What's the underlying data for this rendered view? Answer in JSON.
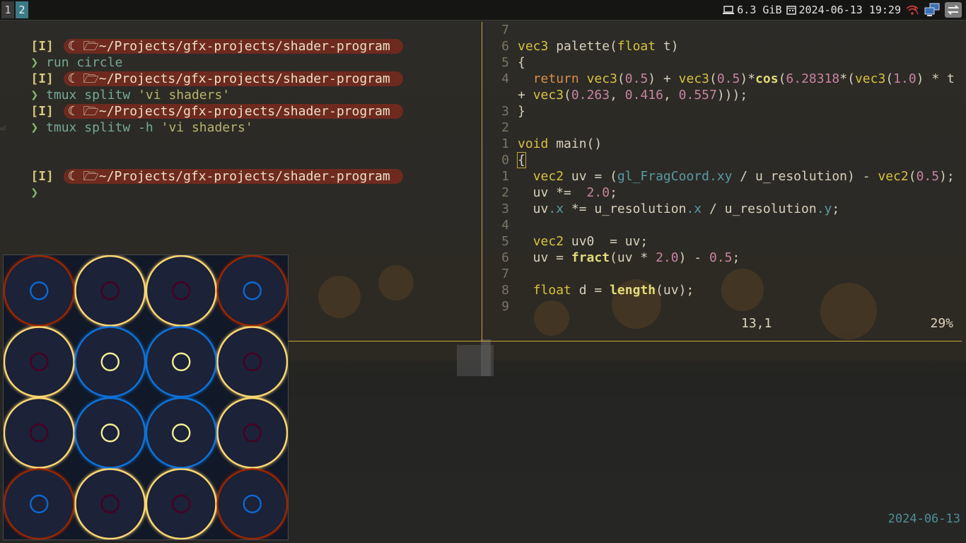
{
  "workspaces": [
    {
      "label": "1",
      "active": false
    },
    {
      "label": "2",
      "active": true
    }
  ],
  "tray": {
    "memory": "6.3 GiB",
    "datetime": "2024-06-13 19:29"
  },
  "terminal": {
    "mode_tag": "[I]",
    "path": "~/Projects/gfx-projects/shader-program",
    "prompt_symbol": "❯",
    "cmd1": "run circle",
    "cmd2_a": "tmux splitw ",
    "cmd2_b": "'vi shaders'",
    "cmd3_a": "tmux splitw -h ",
    "cmd3_b": "'vi shaders'",
    "return_glyph": "⏎"
  },
  "editor": {
    "lines": {
      "l7": "7",
      "l6": "6",
      "l5": "5",
      "l4": "4",
      "l3": "3",
      "l2": "2",
      "l1": "1",
      "l0": "0",
      "m1": "1",
      "m2": "2",
      "m3": "3",
      "m4": "4",
      "m5": "5",
      "m6": "6",
      "m7": "7",
      "m8": "8",
      "m9": "9"
    },
    "status_position": "13,1",
    "status_percent": "29%"
  },
  "bottom_date": "2024-06-13",
  "colors": {
    "accent": "#c8a43a",
    "pill": "#6e2a1f",
    "workspace_active": "#3b7a86"
  }
}
